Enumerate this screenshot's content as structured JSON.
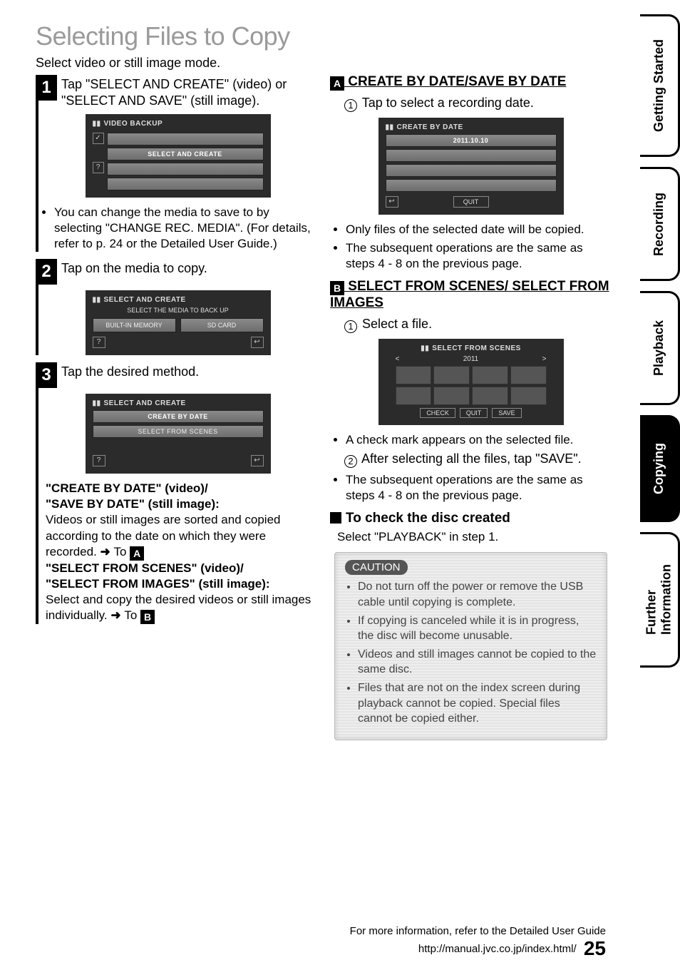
{
  "title": "Selecting Files to Copy",
  "subtitle": "Select video or still image mode.",
  "tabs": [
    "Getting Started",
    "Recording",
    "Playback",
    "Copying",
    "Further\nInformation"
  ],
  "active_tab": 3,
  "step1": {
    "num": "1",
    "text": "Tap \"SELECT AND CREATE\" (video) or \"SELECT AND SAVE\" (still image).",
    "lcd_title": "VIDEO BACKUP",
    "rows": [
      "",
      "SELECT AND CREATE",
      "",
      ""
    ],
    "note": "You can change the media to save to by selecting \"CHANGE REC. MEDIA\". (For details, refer to p. 24 or the Detailed User Guide.)"
  },
  "step2": {
    "num": "2",
    "text": "Tap on the media to copy.",
    "lcd_title": "SELECT AND CREATE",
    "sub": "SELECT THE MEDIA TO BACK UP",
    "btns": [
      "BUILT-IN MEMORY",
      "SD CARD"
    ]
  },
  "step3": {
    "num": "3",
    "text": "Tap the desired method.",
    "lcd_title": "SELECT AND CREATE",
    "rows": [
      "CREATE BY DATE",
      "SELECT FROM SCENES"
    ]
  },
  "methods": {
    "h1a": "\"CREATE BY DATE\" (video)/",
    "h1b": "\"SAVE BY DATE\" (still image):",
    "d1": "Videos or still images are sorted and copied according to the date on which they were recorded. ",
    "to1": "To",
    "h2a": "\"SELECT FROM SCENES\" (video)/",
    "h2b": "\"SELECT FROM IMAGES\" (still image):",
    "d2": "Select and copy the desired videos or still images individually. ",
    "to2": "To"
  },
  "secA": {
    "hdr": " CREATE BY DATE/SAVE BY DATE",
    "s1": "Tap to select a recording date.",
    "lcd_title": "CREATE BY DATE",
    "rows": [
      "2011.10.10",
      "",
      "",
      ""
    ],
    "quit": "QUIT",
    "b1": "Only files of the selected date will be copied.",
    "b2": "The subsequent operations are the same as steps 4 - 8 on the previous page."
  },
  "secB": {
    "hdr": " SELECT FROM SCENES/ SELECT FROM IMAGES",
    "s1": "Select a file.",
    "lcd_title": "SELECT FROM SCENES",
    "year": "2011",
    "foot": [
      "CHECK",
      "QUIT",
      "SAVE"
    ],
    "b1": "A check mark appears on the selected file.",
    "s2": "After selecting all the files, tap \"SAVE\".",
    "b2": "The subsequent operations are the same as steps 4 - 8 on the previous page."
  },
  "check": {
    "hdr": "To check the disc created",
    "text": "Select \"PLAYBACK\" in step 1."
  },
  "caution": {
    "label": "CAUTION",
    "items": [
      "Do not turn off the power or remove the USB cable until copying is complete.",
      "If copying is canceled while it is in progress, the disc will become unusable.",
      "Videos and still images cannot be copied to the same disc.",
      "Files that are not on the index screen during playback cannot be copied. Special files cannot be copied either."
    ]
  },
  "footer": {
    "l1": "For more information, refer to the Detailed User Guide",
    "l2": "http://manual.jvc.co.jp/index.html/",
    "page": "25"
  }
}
